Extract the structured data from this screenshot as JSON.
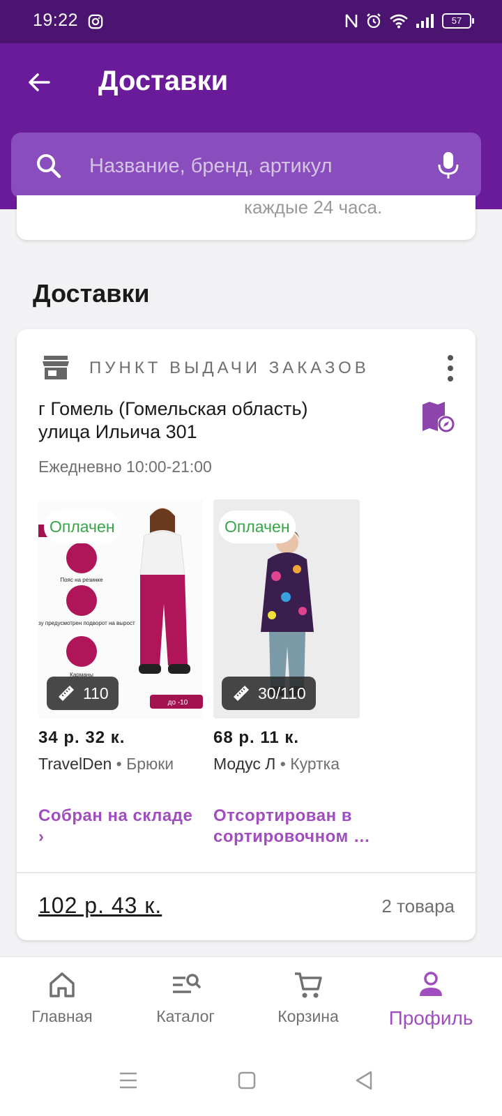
{
  "status_bar": {
    "time": "19:22",
    "battery": "57"
  },
  "header": {
    "title": "Доставки"
  },
  "search": {
    "placeholder": "Название, бренд, артикул"
  },
  "prev_card": {
    "text": "каждые 24 часа."
  },
  "section": {
    "title": "Доставки"
  },
  "delivery": {
    "type_label": "Пункт выдачи заказов",
    "address_line1": "г Гомель (Гомельская область)",
    "address_line2": "улица Ильича 301",
    "hours": "Ежедневно 10:00-21:00",
    "products": [
      {
        "status_badge": "Оплачен",
        "size": "110",
        "price": "34 р. 32 к.",
        "brand": "TravelDen",
        "category": "Брюки",
        "tracking": "Собран на складе ›",
        "image_caption_1": "Пояс на резинке",
        "image_caption_2": "Снизу предусмотрен подворот на вырост",
        "image_caption_3": "Карманы",
        "image_tag": "до -10"
      },
      {
        "status_badge": "Оплачен",
        "size": "30/110",
        "price": "68 р. 11 к.",
        "brand": "Модус Л",
        "category": "Куртка",
        "tracking": "Отсортирован в сортировочном …"
      }
    ],
    "total": "102 р. 43 к.",
    "items_count": "2 товара"
  },
  "bottom_nav": {
    "items": [
      {
        "label": "Главная",
        "icon": "home-icon"
      },
      {
        "label": "Каталог",
        "icon": "catalog-search-icon"
      },
      {
        "label": "Корзина",
        "icon": "cart-icon"
      },
      {
        "label": "Профиль",
        "icon": "profile-icon",
        "active": true
      }
    ]
  },
  "colors": {
    "accent": "#6a1b9a",
    "link": "#a04dbf",
    "paid": "#36a548"
  }
}
